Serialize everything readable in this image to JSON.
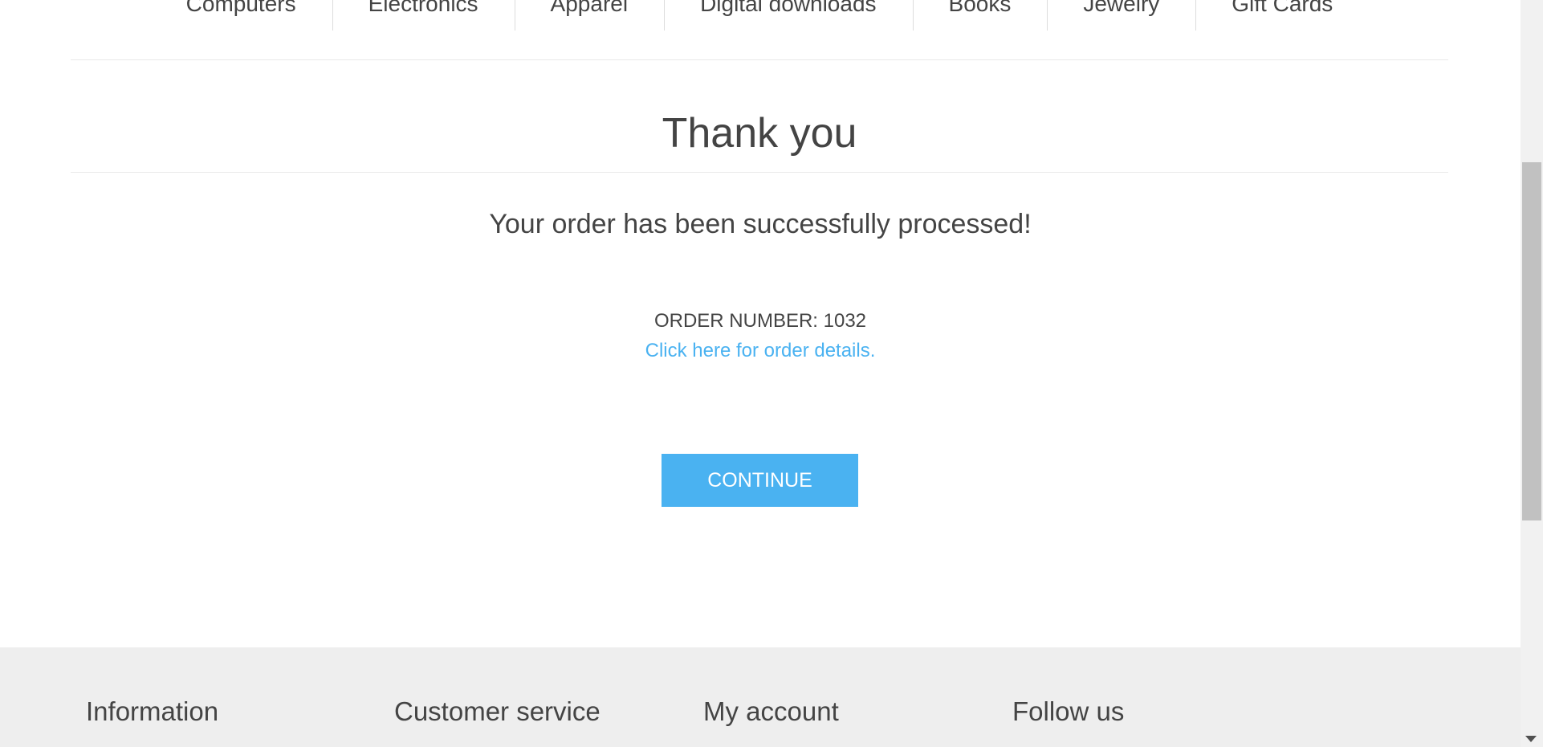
{
  "top_menu": {
    "items": [
      {
        "label": "Computers"
      },
      {
        "label": "Electronics"
      },
      {
        "label": "Apparel"
      },
      {
        "label": "Digital downloads"
      },
      {
        "label": "Books"
      },
      {
        "label": "Jewelry"
      },
      {
        "label": "Gift Cards"
      }
    ]
  },
  "page": {
    "title": "Thank you",
    "order_status": "Your order has been successfully processed!",
    "order_number_label": "ORDER NUMBER:",
    "order_number_value": "1032",
    "details_link": "Click here for order details.",
    "continue_label": "CONTINUE"
  },
  "footer": {
    "columns": [
      {
        "title": "Information"
      },
      {
        "title": "Customer service"
      },
      {
        "title": "My account"
      },
      {
        "title": "Follow us"
      }
    ]
  },
  "colors": {
    "accent": "#4ab2f1",
    "text": "#444444",
    "footer_bg": "#eeeeee",
    "scrollbar_thumb": "#c1c1c1"
  }
}
